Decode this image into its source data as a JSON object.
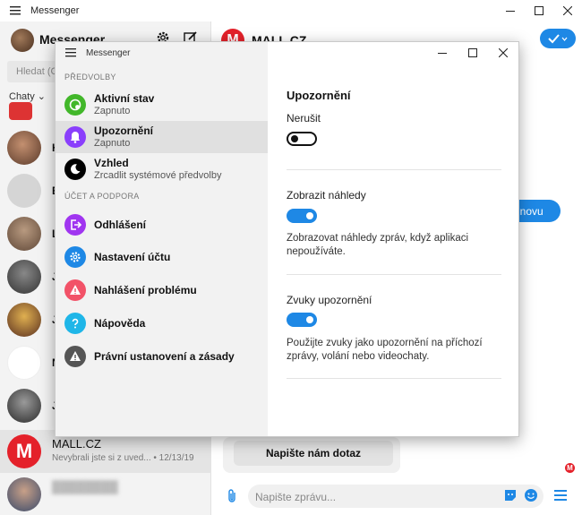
{
  "app": {
    "title": "Messenger",
    "window_controls": [
      "minimize",
      "maximize",
      "close"
    ]
  },
  "sidebar": {
    "title": "Messenger",
    "search_placeholder": "Hledat (Ct",
    "chats_label": "Chaty ⌄",
    "partial_letters": [
      "H",
      "E",
      "L",
      "J",
      "J",
      "N",
      "J"
    ],
    "selected_conversation": {
      "name": "MALL.CZ",
      "preview": "Nevybrali jste si z uved...",
      "date": "• 12/13/19"
    }
  },
  "chat": {
    "name": "MALL.CZ",
    "retry_label": "t znovu",
    "ask_button": "Napište nám dotaz",
    "composer_placeholder": "Napište zprávu...",
    "logo_letter": "M"
  },
  "dialog": {
    "title": "Messenger",
    "sections": {
      "preferences": "PŘEDVOLBY",
      "account": "ÚČET A PODPORA"
    },
    "nav": [
      {
        "label": "Aktivní stav",
        "sub": "Zapnuto",
        "icon": "active-status-icon",
        "color": "#42b72a"
      },
      {
        "label": "Upozornění",
        "sub": "Zapnuto",
        "icon": "bell-icon",
        "color": "#8a3ffc"
      },
      {
        "label": "Vzhled",
        "sub": "Zrcadlit systémové předvolby",
        "icon": "moon-icon",
        "color": "#000000"
      },
      {
        "label": "Odhlášení",
        "icon": "logout-icon",
        "color": "#a035f0"
      },
      {
        "label": "Nastavení účtu",
        "icon": "gear-icon",
        "color": "#1e88e5"
      },
      {
        "label": "Nahlášení problému",
        "icon": "warning-icon",
        "color": "#f25268"
      },
      {
        "label": "Nápověda",
        "icon": "help-icon",
        "color": "#1fb6e8"
      },
      {
        "label": "Právní ustanovení a zásady",
        "icon": "warning-icon",
        "color": "#555555"
      }
    ],
    "notifications": {
      "title": "Upozornění",
      "dnd_label": "Nerušit",
      "dnd_on": false,
      "previews_label": "Zobrazit náhledy",
      "previews_on": true,
      "previews_desc": "Zobrazovat náhledy zpráv, když aplikaci nepoužíváte.",
      "sounds_label": "Zvuky upozornění",
      "sounds_on": true,
      "sounds_desc": "Použijte zvuky jako upozornění na příchozí zprávy, volání nebo videochaty."
    }
  },
  "colors": {
    "accent": "#1e88e5",
    "brand_red": "#e4212a"
  }
}
